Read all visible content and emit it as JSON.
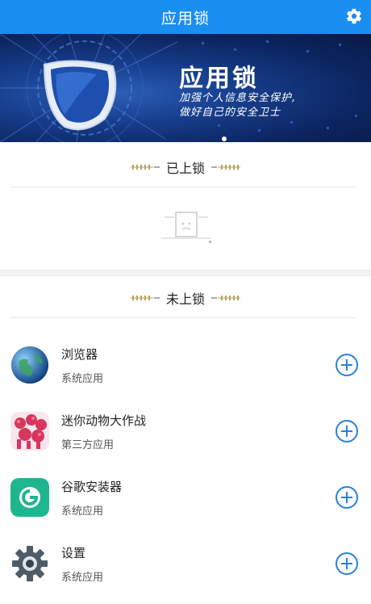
{
  "header": {
    "title": "应用锁",
    "settings_icon": "gear-icon"
  },
  "banner": {
    "title": "应用锁",
    "line1": "加强个人信息安全保护,",
    "line2": "做好自己的安全卫士",
    "icon": "shield-icon",
    "colors": {
      "bg_dark": "#0c2560",
      "bg_light": "#2c5fb8"
    }
  },
  "sections": {
    "locked_label": "已上锁",
    "unlocked_label": "未上锁"
  },
  "apps": [
    {
      "name": "浏览器",
      "type": "系统应用",
      "icon": "browser-globe-icon"
    },
    {
      "name": "迷你动物大作战",
      "type": "第三方应用",
      "icon": "mini-animals-game-icon"
    },
    {
      "name": "谷歌安装器",
      "type": "系统应用",
      "icon": "google-installer-icon"
    },
    {
      "name": "设置",
      "type": "系统应用",
      "icon": "settings-gear-icon"
    }
  ],
  "colors": {
    "accent": "#1b8ef2",
    "add_button": "#2a82d8",
    "ornament": "#b8a35a"
  }
}
